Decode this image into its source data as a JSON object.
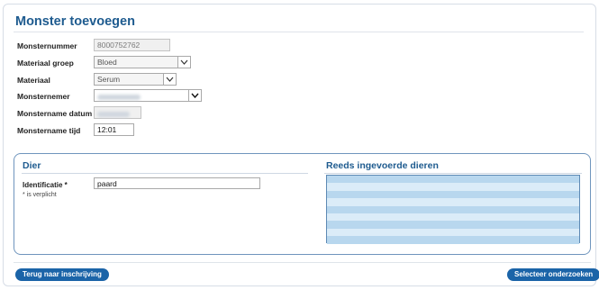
{
  "form": {
    "title": "Monster toevoegen",
    "fields": {
      "monsternummer": {
        "label": "Monsternummer",
        "value": "8000752762"
      },
      "materiaal_groep": {
        "label": "Materiaal groep",
        "value": "Bloed"
      },
      "materiaal": {
        "label": "Materiaal",
        "value": "Serum"
      },
      "monsternemer": {
        "label": "Monsternemer"
      },
      "monstername_datum": {
        "label": "Monstername datum"
      },
      "monstername_tijd": {
        "label": "Monstername tijd",
        "value": "12:01"
      }
    }
  },
  "dier": {
    "title": "Dier",
    "identificatie_label": "Identificatie *",
    "identificatie_value": "paard",
    "required_note": "* is verplicht"
  },
  "reeds": {
    "title": "Reeds ingevoerde dieren",
    "row_count": 9
  },
  "buttons": {
    "back": "Terug naar inschrijving",
    "next": "Selecteer onderzoeken"
  },
  "colors": {
    "title": "#1e5b8f",
    "button": "#1b64a8",
    "section_border": "#6f95bd"
  }
}
